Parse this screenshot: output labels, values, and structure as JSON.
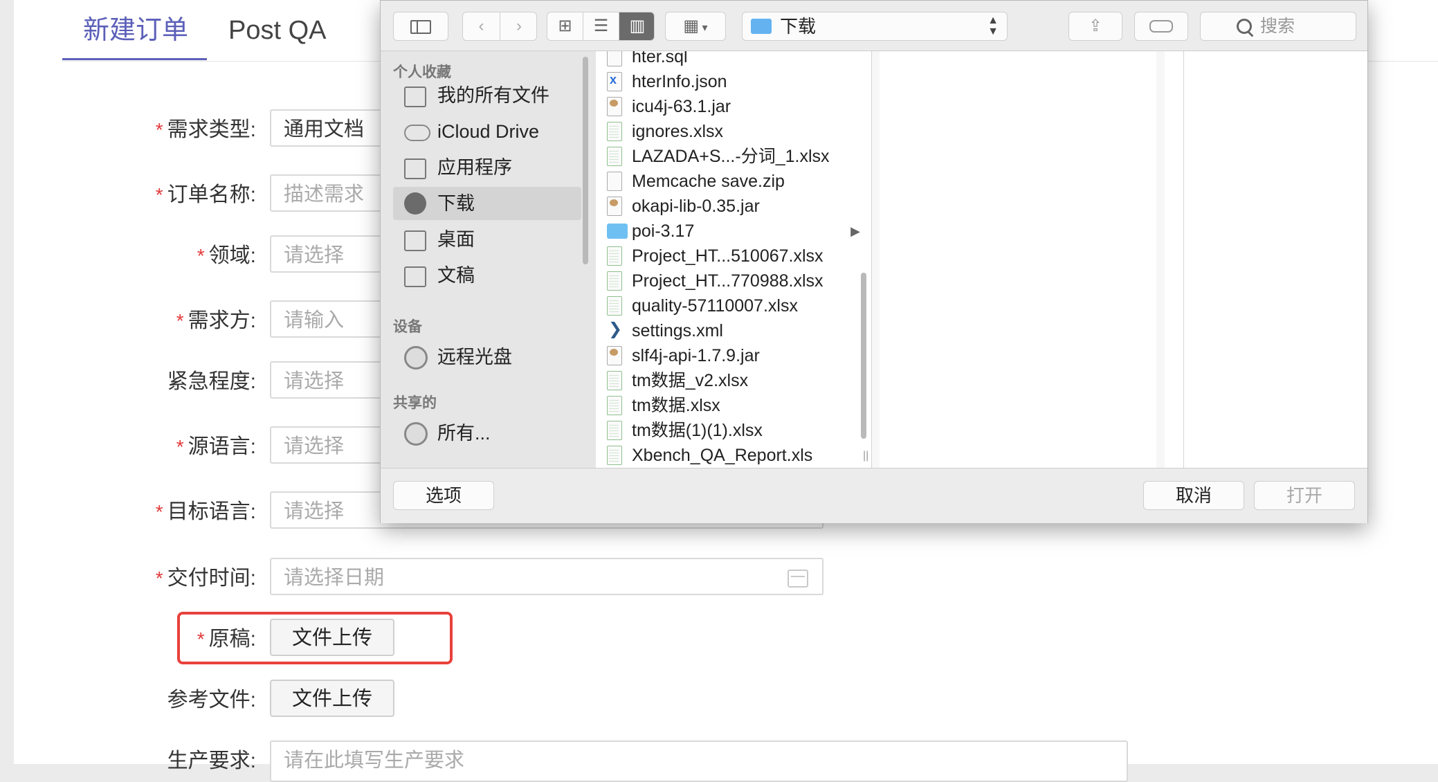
{
  "tabs": [
    {
      "label": "新建订单"
    },
    {
      "label": "Post QA"
    }
  ],
  "form": {
    "rows": [
      {
        "label": "需求类型:",
        "required": true,
        "value": "通用文档",
        "placeholder": ""
      },
      {
        "label": "订单名称:",
        "required": true,
        "value": "",
        "placeholder": "描述需求"
      },
      {
        "label": "领域:",
        "required": true,
        "value": "",
        "placeholder": "请选择"
      },
      {
        "label": "需求方:",
        "required": true,
        "value": "",
        "placeholder": "请输入"
      },
      {
        "label": "紧急程度:",
        "required": false,
        "value": "",
        "placeholder": "请选择"
      },
      {
        "label": "源语言:",
        "required": true,
        "value": "",
        "placeholder": "请选择"
      },
      {
        "label": "目标语言:",
        "required": true,
        "value": "",
        "placeholder": "请选择"
      },
      {
        "label": "交付时间:",
        "required": true,
        "value": "",
        "placeholder": "请选择日期"
      }
    ],
    "original_label": "原稿:",
    "original_button": "文件上传",
    "reference_label": "参考文件:",
    "reference_button": "文件上传",
    "production_label": "生产要求:",
    "production_placeholder": "请在此填写生产要求"
  },
  "dialog": {
    "path_label": "下载",
    "search_placeholder": "搜索",
    "sidebar": {
      "favorites_title": "个人收藏",
      "favorites": [
        {
          "label": "我的所有文件",
          "icon": "all-files-icon"
        },
        {
          "label": "iCloud Drive",
          "icon": "cloud-icon"
        },
        {
          "label": "应用程序",
          "icon": "applications-icon"
        },
        {
          "label": "下载",
          "icon": "download-icon",
          "selected": true
        },
        {
          "label": "桌面",
          "icon": "desktop-icon"
        },
        {
          "label": "文稿",
          "icon": "documents-icon"
        }
      ],
      "devices_title": "设备",
      "devices": [
        {
          "label": "远程光盘",
          "icon": "disc-icon"
        }
      ],
      "shared_title": "共享的",
      "shared": [
        {
          "label": "所有...",
          "icon": "network-icon"
        }
      ]
    },
    "files": [
      {
        "name": "hter.sql",
        "type": "sql"
      },
      {
        "name": "hterInfo.json",
        "type": "json"
      },
      {
        "name": "icu4j-63.1.jar",
        "type": "jar"
      },
      {
        "name": "ignores.xlsx",
        "type": "xlsx"
      },
      {
        "name": "LAZADA+S...-分词_1.xlsx",
        "type": "xlsx"
      },
      {
        "name": "Memcache save.zip",
        "type": "zip"
      },
      {
        "name": "okapi-lib-0.35.jar",
        "type": "jar"
      },
      {
        "name": "poi-3.17",
        "type": "folder"
      },
      {
        "name": "Project_HT...510067.xlsx",
        "type": "xlsx"
      },
      {
        "name": "Project_HT...770988.xlsx",
        "type": "xlsx"
      },
      {
        "name": "quality-57110007.xlsx",
        "type": "xlsx"
      },
      {
        "name": "settings.xml",
        "type": "xml"
      },
      {
        "name": "slf4j-api-1.7.9.jar",
        "type": "jar"
      },
      {
        "name": "tm数据_v2.xlsx",
        "type": "xlsx"
      },
      {
        "name": "tm数据.xlsx",
        "type": "xlsx"
      },
      {
        "name": "tm数据(1)(1).xlsx",
        "type": "xlsx"
      },
      {
        "name": "Xbench_QA_Report.xls",
        "type": "xlsx"
      }
    ],
    "options_button": "选项",
    "cancel_button": "取消",
    "open_button": "打开"
  },
  "colors": {
    "accent": "#5b5fb8",
    "required": "#e23a3a",
    "highlight": "#e8413c"
  }
}
